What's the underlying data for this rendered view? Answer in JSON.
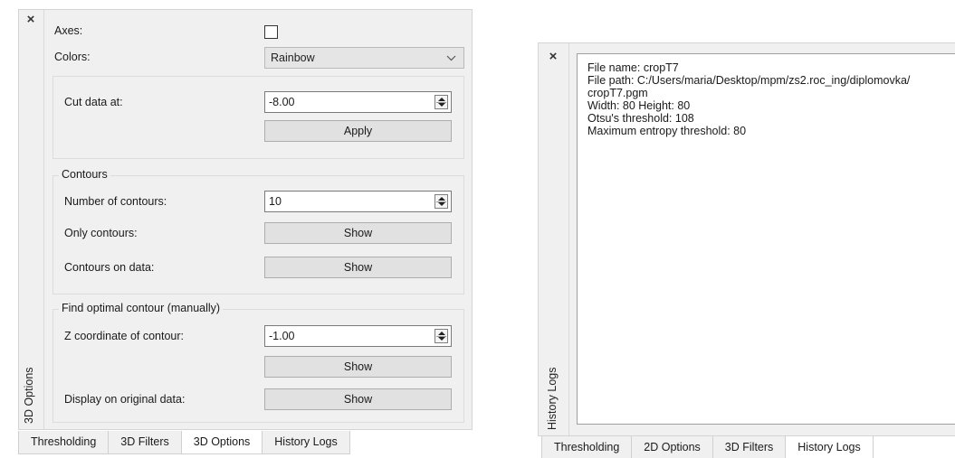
{
  "options_panel": {
    "close_glyph": "×",
    "dock_title": "3D Options",
    "axes": {
      "label": "Axes:",
      "checked": false
    },
    "colors": {
      "label": "Colors:",
      "selected": "Rainbow"
    },
    "cut": {
      "label": "Cut data at:",
      "value": "-8.00",
      "apply_label": "Apply"
    },
    "contours": {
      "title": "Contours",
      "number_label": "Number of contours:",
      "number_value": "10",
      "only_label": "Only contours:",
      "only_button": "Show",
      "on_data_label": "Contours on data:",
      "on_data_button": "Show"
    },
    "optimal": {
      "title": "Find optimal contour (manually)",
      "z_label": "Z coordinate of contour:",
      "z_value": "-1.00",
      "show_button": "Show",
      "display_label": "Display on original data:",
      "display_button": "Show"
    },
    "tabs": [
      {
        "label": "Thresholding",
        "active": false
      },
      {
        "label": "3D Filters",
        "active": false
      },
      {
        "label": "3D Options",
        "active": true
      },
      {
        "label": "History Logs",
        "active": false
      }
    ]
  },
  "history_panel": {
    "close_glyph": "×",
    "dock_title": "History Logs",
    "log_lines": [
      "File name: cropT7",
      "File path: C:/Users/maria/Desktop/mpm/zs2.roc_ing/diplomovka/",
      "cropT7.pgm",
      "Width: 80 Height: 80",
      "Otsu's threshold: 108",
      "Maximum entropy threshold: 80"
    ],
    "tabs": [
      {
        "label": "Thresholding",
        "active": false
      },
      {
        "label": "2D Options",
        "active": false
      },
      {
        "label": "3D Filters",
        "active": false
      },
      {
        "label": "History Logs",
        "active": true
      }
    ]
  }
}
